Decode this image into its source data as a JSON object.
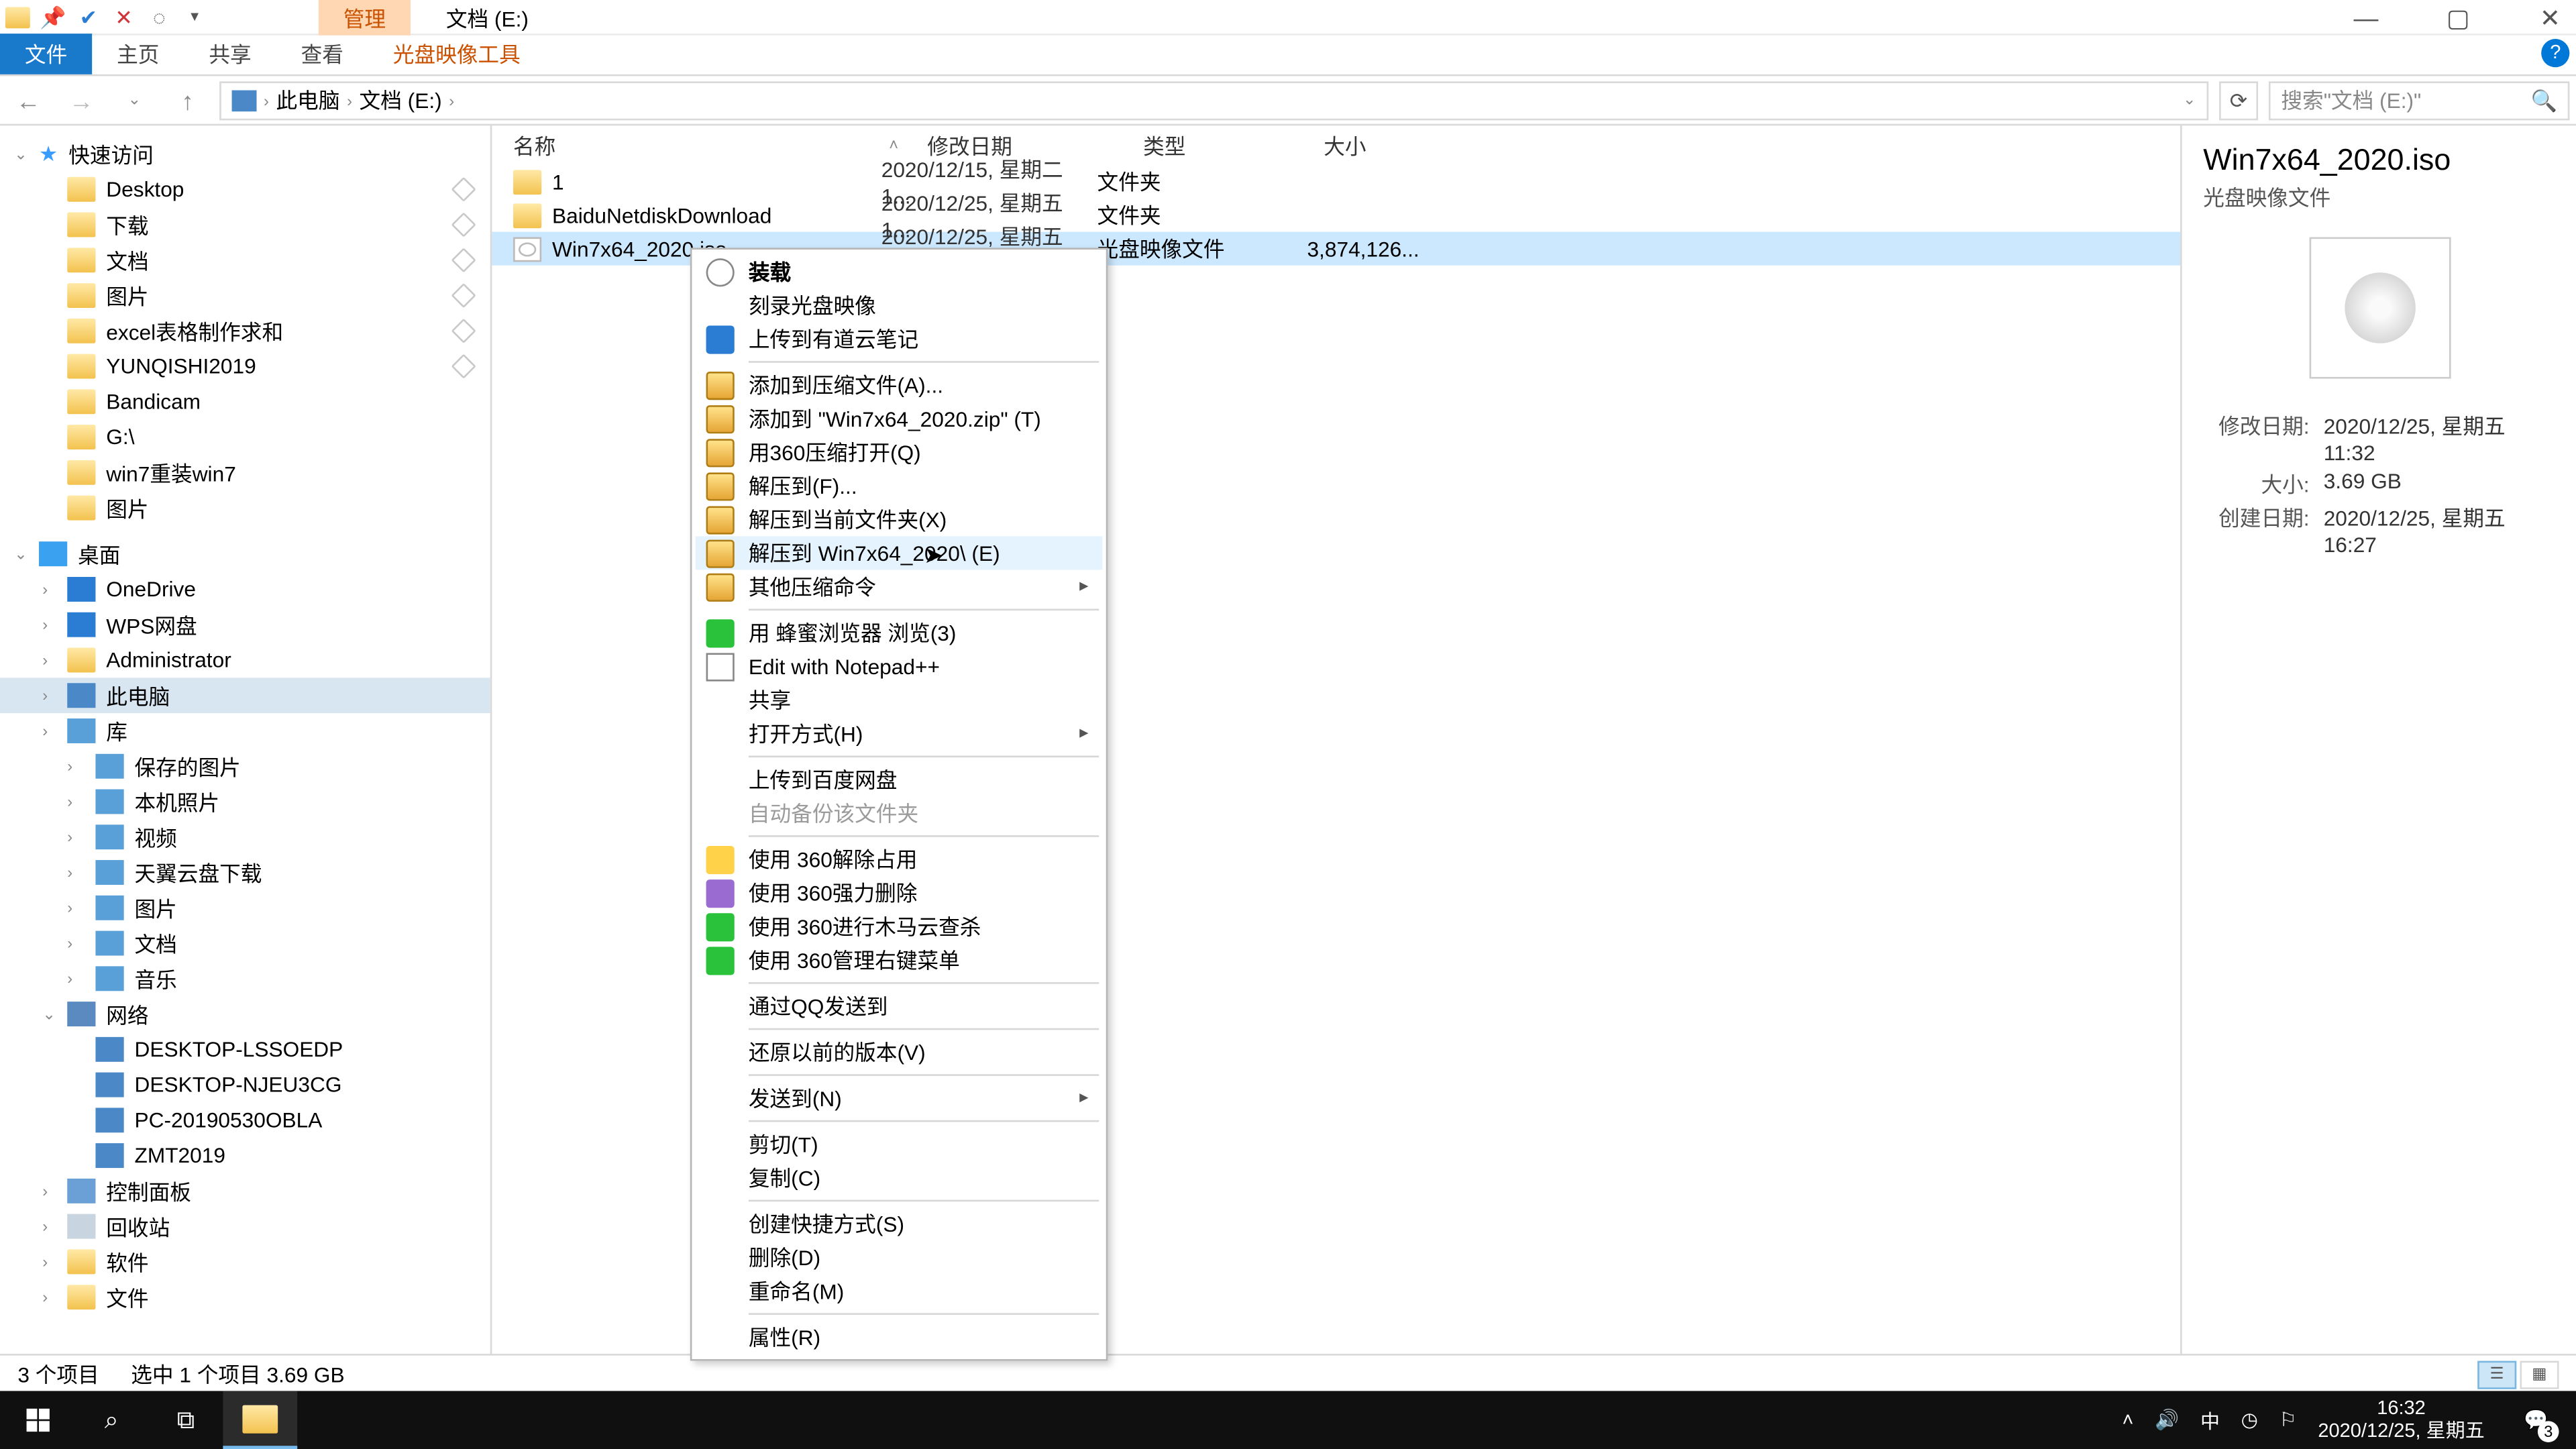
{
  "window": {
    "title": "文档 (E:)",
    "contextual_tab_label": "管理"
  },
  "ribbon_tabs": {
    "file": "文件",
    "home": "主页",
    "share": "共享",
    "view": "查看",
    "contextual": "光盘映像工具"
  },
  "address": {
    "root": "此电脑",
    "current": "文档 (E:)"
  },
  "search": {
    "placeholder": "搜索\"文档 (E:)\""
  },
  "sidebar": {
    "quick_access": "快速访问",
    "quick_items": [
      {
        "label": "Desktop",
        "pin": true
      },
      {
        "label": "下载",
        "pin": true
      },
      {
        "label": "文档",
        "pin": true
      },
      {
        "label": "图片",
        "pin": true
      },
      {
        "label": "excel表格制作求和",
        "pin": true
      },
      {
        "label": "YUNQISHI2019",
        "pin": true
      },
      {
        "label": "Bandicam"
      },
      {
        "label": "G:\\"
      },
      {
        "label": "win7重装win7"
      },
      {
        "label": "图片"
      }
    ],
    "desktop_root": "桌面",
    "desktop_items": [
      {
        "label": "OneDrive",
        "ic": "cloud"
      },
      {
        "label": "WPS网盘",
        "ic": "cloud"
      },
      {
        "label": "Administrator",
        "ic": "folder"
      },
      {
        "label": "此电脑",
        "ic": "pc",
        "sel": true
      },
      {
        "label": "库",
        "ic": "lib"
      }
    ],
    "lib_items": [
      "保存的图片",
      "本机照片",
      "视频",
      "天翼云盘下载",
      "图片",
      "文档",
      "音乐"
    ],
    "network": "网络",
    "network_items": [
      "DESKTOP-LSSOEDP",
      "DESKTOP-NJEU3CG",
      "PC-20190530OBLA",
      "ZMT2019"
    ],
    "tail_items": [
      {
        "label": "控制面板",
        "ic": "panel"
      },
      {
        "label": "回收站",
        "ic": "bin"
      },
      {
        "label": "软件",
        "ic": "folder"
      },
      {
        "label": "文件",
        "ic": "folder"
      }
    ]
  },
  "columns": {
    "name": "名称",
    "date": "修改日期",
    "type": "类型",
    "size": "大小"
  },
  "files": [
    {
      "name": "1",
      "date": "2020/12/15, 星期二 1...",
      "type": "文件夹",
      "size": "",
      "ic": "folder"
    },
    {
      "name": "BaiduNetdiskDownload",
      "date": "2020/12/25, 星期五 1...",
      "type": "文件夹",
      "size": "",
      "ic": "folder"
    },
    {
      "name": "Win7x64_2020.iso",
      "date": "2020/12/25, 星期五 1...",
      "type": "光盘映像文件",
      "size": "3,874,126...",
      "ic": "iso",
      "sel": true
    }
  ],
  "details": {
    "title": "Win7x64_2020.iso",
    "subtitle": "光盘映像文件",
    "rows": [
      {
        "k": "修改日期:",
        "v": "2020/12/25, 星期五 11:32"
      },
      {
        "k": "大小:",
        "v": "3.69 GB"
      },
      {
        "k": "创建日期:",
        "v": "2020/12/25, 星期五 16:27"
      }
    ]
  },
  "status": {
    "count": "3 个项目",
    "selection": "选中 1 个项目  3.69 GB"
  },
  "context_menu": [
    {
      "label": "装载",
      "ic": "circle",
      "bold": true
    },
    {
      "label": "刻录光盘映像"
    },
    {
      "label": "上传到有道云笔记",
      "ic": "blue"
    },
    {
      "sep": true
    },
    {
      "label": "添加到压缩文件(A)...",
      "ic": "zip"
    },
    {
      "label": "添加到 \"Win7x64_2020.zip\" (T)",
      "ic": "zip"
    },
    {
      "label": "用360压缩打开(Q)",
      "ic": "zip"
    },
    {
      "label": "解压到(F)...",
      "ic": "zip"
    },
    {
      "label": "解压到当前文件夹(X)",
      "ic": "zip"
    },
    {
      "label": "解压到 Win7x64_2020\\ (E)",
      "ic": "zip",
      "hl": true
    },
    {
      "label": "其他压缩命令",
      "ic": "zip",
      "arrow": true
    },
    {
      "sep": true
    },
    {
      "label": "用 蜂蜜浏览器 浏览(3)",
      "ic": "360"
    },
    {
      "label": "Edit with Notepad++",
      "ic": "note"
    },
    {
      "label": "共享",
      "ic": "share"
    },
    {
      "label": "打开方式(H)",
      "arrow": true
    },
    {
      "sep": true
    },
    {
      "label": "上传到百度网盘",
      "ic": "cloud"
    },
    {
      "label": "自动备份该文件夹",
      "disabled": true
    },
    {
      "sep": true
    },
    {
      "label": "使用 360解除占用",
      "ic": "shield"
    },
    {
      "label": "使用 360强力删除",
      "ic": "del"
    },
    {
      "label": "使用 360进行木马云查杀",
      "ic": "360"
    },
    {
      "label": "使用 360管理右键菜单",
      "ic": "360"
    },
    {
      "sep": true
    },
    {
      "label": "通过QQ发送到"
    },
    {
      "sep": true
    },
    {
      "label": "还原以前的版本(V)"
    },
    {
      "sep": true
    },
    {
      "label": "发送到(N)",
      "arrow": true
    },
    {
      "sep": true
    },
    {
      "label": "剪切(T)"
    },
    {
      "label": "复制(C)"
    },
    {
      "sep": true
    },
    {
      "label": "创建快捷方式(S)"
    },
    {
      "label": "删除(D)"
    },
    {
      "label": "重命名(M)"
    },
    {
      "sep": true
    },
    {
      "label": "属性(R)"
    }
  ],
  "taskbar": {
    "time": "16:32",
    "date": "2020/12/25, 星期五",
    "notif_count": "3",
    "ime": "中"
  }
}
